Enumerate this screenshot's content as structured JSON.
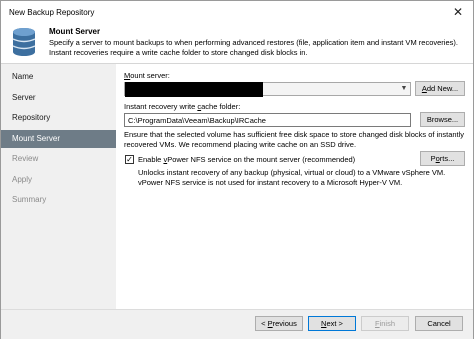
{
  "window": {
    "title": "New Backup Repository",
    "close_glyph": "✕"
  },
  "header": {
    "title": "Mount Server",
    "description_line1": "Specify a server to mount backups to when performing advanced restores (file, application item and instant VM recoveries).",
    "description_line2": "Instant recoveries require a write cache folder to store changed disk blocks in.",
    "icon": "database-icon"
  },
  "sidebar": {
    "items": [
      {
        "label": "Name",
        "state": "normal"
      },
      {
        "label": "Server",
        "state": "normal"
      },
      {
        "label": "Repository",
        "state": "normal"
      },
      {
        "label": "Mount Server",
        "state": "active"
      },
      {
        "label": "Review",
        "state": "disabled"
      },
      {
        "label": "Apply",
        "state": "disabled"
      },
      {
        "label": "Summary",
        "state": "disabled"
      }
    ]
  },
  "mount_server": {
    "label_u": "M",
    "label_rest": "ount server:",
    "add_new_u": "A",
    "add_new_rest": "dd New..."
  },
  "write_cache": {
    "label_a": "Instant recovery write ",
    "label_u": "c",
    "label_b": "ache folder:",
    "value": "C:\\ProgramData\\Veeam\\Backup\\IRCache",
    "browse_label": "Browse...",
    "hint_line1": "Ensure that the selected volume has sufficient free disk space to store changed disk blocks of instantly",
    "hint_line2": "recovered VMs. We recommend placing write cache on an SSD drive."
  },
  "nfs": {
    "checked": true,
    "check_glyph": "✓",
    "label_a": "Enable ",
    "label_u": "v",
    "label_b": "Power NFS service on the mount server (recommended)",
    "ports_a": "P",
    "ports_u": "o",
    "ports_b": "rts...",
    "desc_line1": "Unlocks instant recovery of any backup (physical, virtual or cloud) to a VMware vSphere VM.",
    "desc_line2": "vPower NFS service is not used for instant recovery to a Microsoft Hyper-V VM."
  },
  "footer": {
    "previous_a": "< ",
    "previous_u": "P",
    "previous_b": "revious",
    "next_u": "N",
    "next_b": "ext >",
    "finish_u": "F",
    "finish_b": "inish",
    "cancel_label": "Cancel"
  },
  "colors": {
    "accent": "#0078d7",
    "sidebar_active": "#6e7c87",
    "sidebar_bg": "#f0f0f0"
  }
}
